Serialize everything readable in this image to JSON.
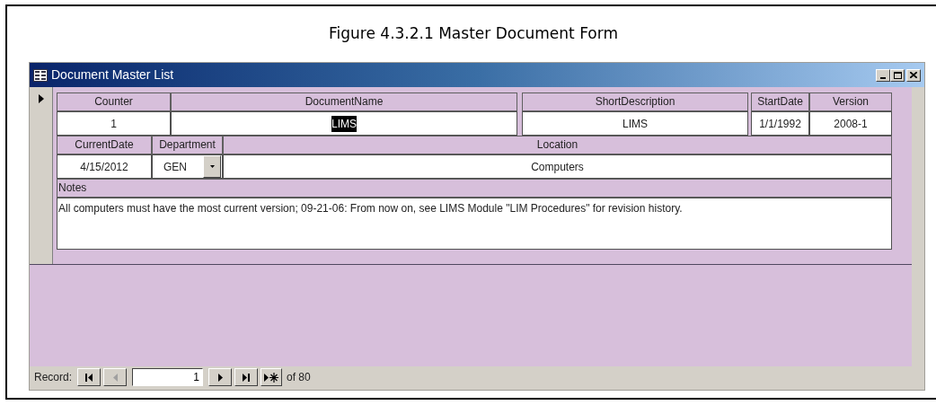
{
  "caption": "Figure 4.3.2.1 Master Document Form",
  "window": {
    "title": "Document Master List"
  },
  "form": {
    "rows": [
      [
        {
          "kind": "text",
          "label": "Counter",
          "value": "1",
          "selected": false
        },
        {
          "kind": "text",
          "label": "DocumentName",
          "value": "LIMS",
          "selected": true
        },
        {
          "kind": "text",
          "label": "ShortDescription",
          "value": "LIMS",
          "selected": false
        },
        {
          "kind": "text",
          "label": "StartDate",
          "value": "1/1/1992",
          "selected": false
        },
        {
          "kind": "text",
          "label": "Version",
          "value": "2008-1",
          "selected": false
        }
      ],
      [
        {
          "kind": "text",
          "label": "CurrentDate",
          "value": "4/15/2012",
          "selected": false
        },
        {
          "kind": "combo",
          "label": "Department",
          "value": "GEN",
          "selected": false
        },
        {
          "kind": "text",
          "label": "Location",
          "value": "Computers",
          "selected": false
        }
      ],
      [
        {
          "kind": "memo",
          "label": "Notes",
          "value": "All computers must have the most current version; 09-21-06: From now on, see LIMS Module \"LIM Procedures\" for revision history.",
          "selected": false
        }
      ]
    ]
  },
  "navigator": {
    "label": "Record:",
    "current": "1",
    "total": "of 80",
    "buttons": [
      {
        "kind": "first",
        "disabled": false
      },
      {
        "kind": "prev",
        "disabled": true
      },
      {
        "kind": "next",
        "disabled": false
      },
      {
        "kind": "last",
        "disabled": false
      },
      {
        "kind": "new",
        "disabled": false
      }
    ]
  }
}
